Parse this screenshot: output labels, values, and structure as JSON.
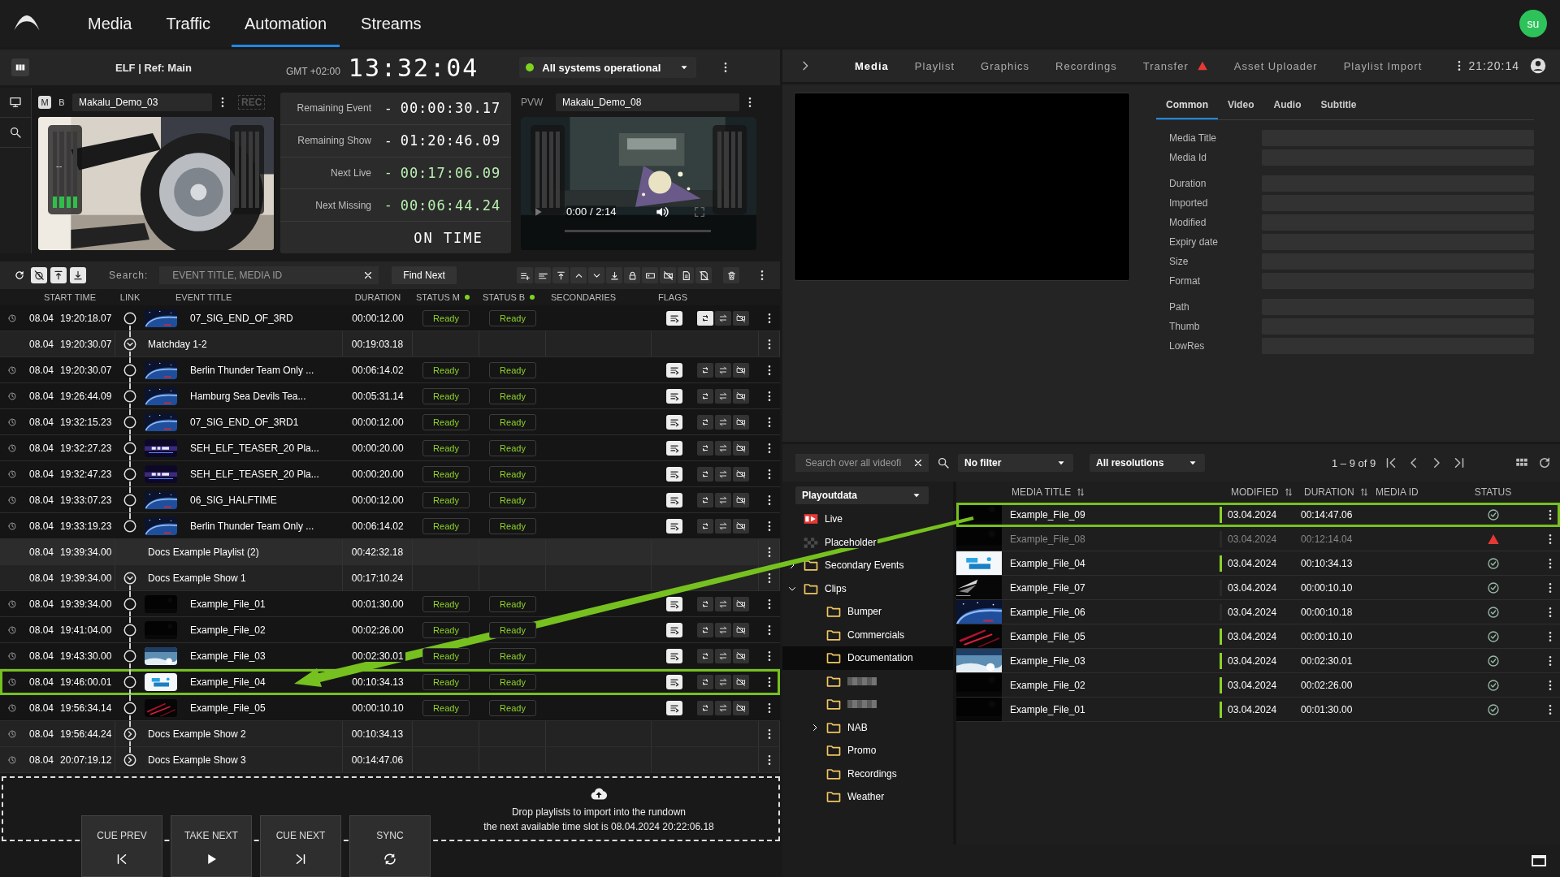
{
  "nav": {
    "tabs": [
      {
        "label": "Media",
        "selected": false
      },
      {
        "label": "Traffic",
        "selected": false
      },
      {
        "label": "Automation",
        "selected": true
      },
      {
        "label": "Streams",
        "selected": false
      }
    ],
    "avatar": "su"
  },
  "rundown_header": {
    "title": "ELF | Ref: Main",
    "timezone": "GMT +02:00",
    "clock": "13:32:04",
    "status": {
      "label": "All systems operational",
      "healthy": true
    }
  },
  "program": {
    "modes": [
      {
        "label": "M",
        "selected": true
      },
      {
        "label": "B",
        "selected": false
      }
    ],
    "clip": "Makalu_Demo_03",
    "rec": "REC",
    "recording": false,
    "meter": {
      "reading": "--",
      "level": 0.15
    }
  },
  "timers": [
    {
      "label": "Remaining Event",
      "sign": "-",
      "value": "00:00:30.17",
      "accent": false
    },
    {
      "label": "Remaining Show",
      "sign": "-",
      "value": "01:20:46.09",
      "accent": false
    },
    {
      "label": "Next Live",
      "sign": "-",
      "value": "00:17:06.09",
      "accent": true
    },
    {
      "label": "Next Missing",
      "sign": "-",
      "value": "00:06:44.24",
      "accent": true
    }
  ],
  "timing_status": "ON TIME",
  "preview": {
    "label": "PVW",
    "clip": "Makalu_Demo_08",
    "player_time": "0:00 / 2:14"
  },
  "toolbar": {
    "toggles": [
      {
        "on": false
      },
      {
        "on": true
      },
      {
        "on": true
      },
      {
        "on": true
      }
    ],
    "search_label": "Search:",
    "placeholder": "EVENT TITLE, MEDIA ID",
    "find_button": "Find Next"
  },
  "rundown": {
    "columns": [
      {
        "label": "START TIME"
      },
      {
        "label": "LINK"
      },
      {
        "label": "EVENT TITLE"
      },
      {
        "label": "DURATION"
      },
      {
        "label": "STATUS M",
        "online": true
      },
      {
        "label": "STATUS B",
        "online": true
      },
      {
        "label": "SECONDARIES"
      },
      {
        "label": "FLAGS"
      }
    ],
    "rows": [
      {
        "kind": "event",
        "scheduled": true,
        "linked": true,
        "date": "08.04",
        "time": "19:20:18.07",
        "title": "07_SIG_END_OF_3RD",
        "duration": "00:00:12.00",
        "status_m": "Ready",
        "status_b": "Ready",
        "loop": true,
        "highlighted": false
      },
      {
        "kind": "group",
        "scheduled": false,
        "linked": true,
        "expanded": true,
        "date": "08.04",
        "time": "19:20:30.07",
        "title": "Matchday 1-2",
        "duration": "00:19:03.18"
      },
      {
        "kind": "event",
        "scheduled": true,
        "linked": true,
        "date": "08.04",
        "time": "19:20:30.07",
        "title": "Berlin Thunder Team Only ...",
        "duration": "00:06:14.02",
        "status_m": "Ready",
        "status_b": "Ready",
        "loop": false,
        "highlighted": false
      },
      {
        "kind": "event",
        "scheduled": true,
        "linked": true,
        "date": "08.04",
        "time": "19:26:44.09",
        "title": "Hamburg Sea Devils Tea...",
        "duration": "00:05:31.14",
        "status_m": "Ready",
        "status_b": "Ready",
        "loop": false,
        "highlighted": false
      },
      {
        "kind": "event",
        "scheduled": true,
        "linked": true,
        "date": "08.04",
        "time": "19:32:15.23",
        "title": "07_SIG_END_OF_3RD1",
        "duration": "00:00:12.00",
        "status_m": "Ready",
        "status_b": "Ready",
        "loop": false,
        "highlighted": false
      },
      {
        "kind": "event",
        "scheduled": true,
        "linked": true,
        "date": "08.04",
        "time": "19:32:27.23",
        "title": "SEH_ELF_TEASER_20 Pla...",
        "duration": "00:00:20.00",
        "status_m": "Ready",
        "status_b": "Ready",
        "loop": false,
        "highlighted": false
      },
      {
        "kind": "event",
        "scheduled": true,
        "linked": true,
        "date": "08.04",
        "time": "19:32:47.23",
        "title": "SEH_ELF_TEASER_20 Pla...",
        "duration": "00:00:20.00",
        "status_m": "Ready",
        "status_b": "Ready",
        "loop": false,
        "highlighted": false
      },
      {
        "kind": "event",
        "scheduled": true,
        "linked": true,
        "date": "08.04",
        "time": "19:33:07.23",
        "title": "06_SIG_HALFTIME",
        "duration": "00:00:12.00",
        "status_m": "Ready",
        "status_b": "Ready",
        "loop": false,
        "highlighted": false
      },
      {
        "kind": "event",
        "scheduled": true,
        "linked": true,
        "date": "08.04",
        "time": "19:33:19.23",
        "title": "Berlin Thunder Team Only ...",
        "duration": "00:06:14.02",
        "status_m": "Ready",
        "status_b": "Ready",
        "loop": false,
        "highlighted": false
      },
      {
        "kind": "playlist",
        "scheduled": false,
        "linked": false,
        "date": "08.04",
        "time": "19:39:34.00",
        "title": "Docs Example Playlist (2)",
        "duration": "00:42:32.18"
      },
      {
        "kind": "group",
        "scheduled": false,
        "linked": true,
        "expanded": true,
        "date": "08.04",
        "time": "19:39:34.00",
        "title": "Docs Example Show 1",
        "duration": "00:17:10.24"
      },
      {
        "kind": "event",
        "scheduled": true,
        "linked": true,
        "date": "08.04",
        "time": "19:39:34.00",
        "title": "Example_File_01",
        "duration": "00:01:30.00",
        "status_m": "Ready",
        "status_b": "Ready",
        "loop": false,
        "highlighted": false
      },
      {
        "kind": "event",
        "scheduled": true,
        "linked": true,
        "date": "08.04",
        "time": "19:41:04.00",
        "title": "Example_File_02",
        "duration": "00:02:26.00",
        "status_m": "Ready",
        "status_b": "Ready",
        "loop": false,
        "highlighted": false
      },
      {
        "kind": "event",
        "scheduled": true,
        "linked": true,
        "date": "08.04",
        "time": "19:43:30.00",
        "title": "Example_File_03",
        "duration": "00:02:30.01",
        "status_m": "Ready",
        "status_b": "Ready",
        "loop": false,
        "highlighted": false
      },
      {
        "kind": "event",
        "scheduled": true,
        "linked": true,
        "date": "08.04",
        "time": "19:46:00.01",
        "title": "Example_File_04",
        "duration": "00:10:34.13",
        "status_m": "Ready",
        "status_b": "Ready",
        "loop": false,
        "highlighted": true
      },
      {
        "kind": "event",
        "scheduled": true,
        "linked": true,
        "date": "08.04",
        "time": "19:56:34.14",
        "title": "Example_File_05",
        "duration": "00:00:10.10",
        "status_m": "Ready",
        "status_b": "Ready",
        "loop": false,
        "highlighted": false
      },
      {
        "kind": "group",
        "scheduled": true,
        "linked": true,
        "expanded": false,
        "date": "08.04",
        "time": "19:56:44.24",
        "title": "Docs Example Show 2",
        "duration": "00:10:34.13"
      },
      {
        "kind": "group",
        "scheduled": true,
        "linked": true,
        "expanded": false,
        "date": "08.04",
        "time": "20:07:19.12",
        "title": "Docs Example Show 3",
        "duration": "00:14:47.06"
      }
    ]
  },
  "dropzone": {
    "text": "Drop playlists to import into the rundown",
    "slot": "the next available time slot is 08.04.2024 20:22:06.18"
  },
  "controls": [
    {
      "label": "CUE PREV",
      "kind": "prev"
    },
    {
      "label": "TAKE NEXT",
      "kind": "play"
    },
    {
      "label": "CUE NEXT",
      "kind": "next"
    },
    {
      "label": "SYNC",
      "kind": "sync"
    }
  ],
  "media_panel": {
    "tabs": [
      {
        "label": "Media",
        "selected": true,
        "warning": false
      },
      {
        "label": "Playlist",
        "selected": false,
        "warning": false
      },
      {
        "label": "Graphics",
        "selected": false,
        "warning": false
      },
      {
        "label": "Recordings",
        "selected": false,
        "warning": false
      },
      {
        "label": "Transfer",
        "selected": false,
        "warning": true
      },
      {
        "label": "Asset Uploader",
        "selected": false,
        "warning": false
      },
      {
        "label": "Playlist Import",
        "selected": false,
        "warning": false
      }
    ],
    "clock": "21:20:14"
  },
  "details": {
    "tabs": [
      {
        "label": "Common",
        "selected": true
      },
      {
        "label": "Video",
        "selected": false
      },
      {
        "label": "Audio",
        "selected": false
      },
      {
        "label": "Subtitle",
        "selected": false
      }
    ],
    "field_groups": [
      {
        "fields": [
          {
            "label": "Media Title"
          },
          {
            "label": "Media Id"
          }
        ]
      },
      {
        "fields": [
          {
            "label": "Duration"
          },
          {
            "label": "Imported"
          },
          {
            "label": "Modified"
          },
          {
            "label": "Expiry date"
          },
          {
            "label": "Size"
          },
          {
            "label": "Format"
          }
        ]
      },
      {
        "fields": [
          {
            "label": "Path"
          },
          {
            "label": "Thumb"
          },
          {
            "label": "LowRes"
          }
        ]
      }
    ]
  },
  "browser": {
    "placeholder": "Search over all videofi",
    "filter": "No filter",
    "resolution": "All resolutions",
    "pager": "1 – 9 of 9",
    "library": "Playoutdata",
    "tree": [
      {
        "label": "Live",
        "kind": "live",
        "selected": false
      },
      {
        "label": "Placeholder",
        "kind": "placeholder",
        "selected": false
      },
      {
        "label": "Secondary Events",
        "kind": "folder",
        "expanded": false,
        "selected": false
      },
      {
        "label": "Clips",
        "kind": "folder",
        "expanded": true,
        "selected": false,
        "children": [
          {
            "label": "Bumper",
            "kind": "folder",
            "selected": false
          },
          {
            "label": "Commercials",
            "kind": "folder",
            "selected": false
          },
          {
            "label": "Documentation",
            "kind": "folder",
            "selected": true
          },
          {
            "kind": "redacted",
            "selected": false
          },
          {
            "kind": "redacted",
            "selected": false
          },
          {
            "label": "NAB",
            "kind": "folder",
            "expanded": false,
            "selected": false
          },
          {
            "label": "Promo",
            "kind": "folder",
            "selected": false
          },
          {
            "label": "Recordings",
            "kind": "folder",
            "selected": false
          },
          {
            "label": "Weather",
            "kind": "folder",
            "selected": false
          }
        ]
      }
    ],
    "columns": [
      {
        "label": "MEDIA TITLE",
        "sortable": true
      },
      {
        "label": "MODIFIED",
        "sortable": true
      },
      {
        "label": "DURATION",
        "sortable": true
      },
      {
        "label": "MEDIA ID",
        "sortable": false
      },
      {
        "label": "STATUS",
        "sortable": false
      }
    ],
    "rows": [
      {
        "title": "Example_File_09",
        "marked": true,
        "modified": "03.04.2024",
        "duration": "00:14:47.06",
        "warning": false,
        "available": true,
        "highlighted": true
      },
      {
        "title": "Example_File_08",
        "marked": false,
        "modified": "03.04.2024",
        "duration": "00:12:14.04",
        "warning": true,
        "available": false,
        "highlighted": false
      },
      {
        "title": "Example_File_04",
        "marked": true,
        "modified": "03.04.2024",
        "duration": "00:10:34.13",
        "warning": false,
        "available": true,
        "highlighted": false
      },
      {
        "title": "Example_File_07",
        "marked": false,
        "modified": "03.04.2024",
        "duration": "00:00:10.10",
        "warning": false,
        "available": true,
        "highlighted": false
      },
      {
        "title": "Example_File_06",
        "marked": false,
        "modified": "03.04.2024",
        "duration": "00:00:10.18",
        "warning": false,
        "available": true,
        "highlighted": false
      },
      {
        "title": "Example_File_05",
        "marked": true,
        "modified": "03.04.2024",
        "duration": "00:00:10.10",
        "warning": false,
        "available": true,
        "highlighted": false
      },
      {
        "title": "Example_File_03",
        "marked": true,
        "modified": "03.04.2024",
        "duration": "00:02:30.01",
        "warning": false,
        "available": true,
        "highlighted": false
      },
      {
        "title": "Example_File_02",
        "marked": true,
        "modified": "03.04.2024",
        "duration": "00:02:26.00",
        "warning": false,
        "available": true,
        "highlighted": false
      },
      {
        "title": "Example_File_01",
        "marked": true,
        "modified": "03.04.2024",
        "duration": "00:01:30.00",
        "warning": false,
        "available": true,
        "highlighted": false
      }
    ]
  },
  "annotations": [
    {
      "kind": "arrow"
    }
  ]
}
